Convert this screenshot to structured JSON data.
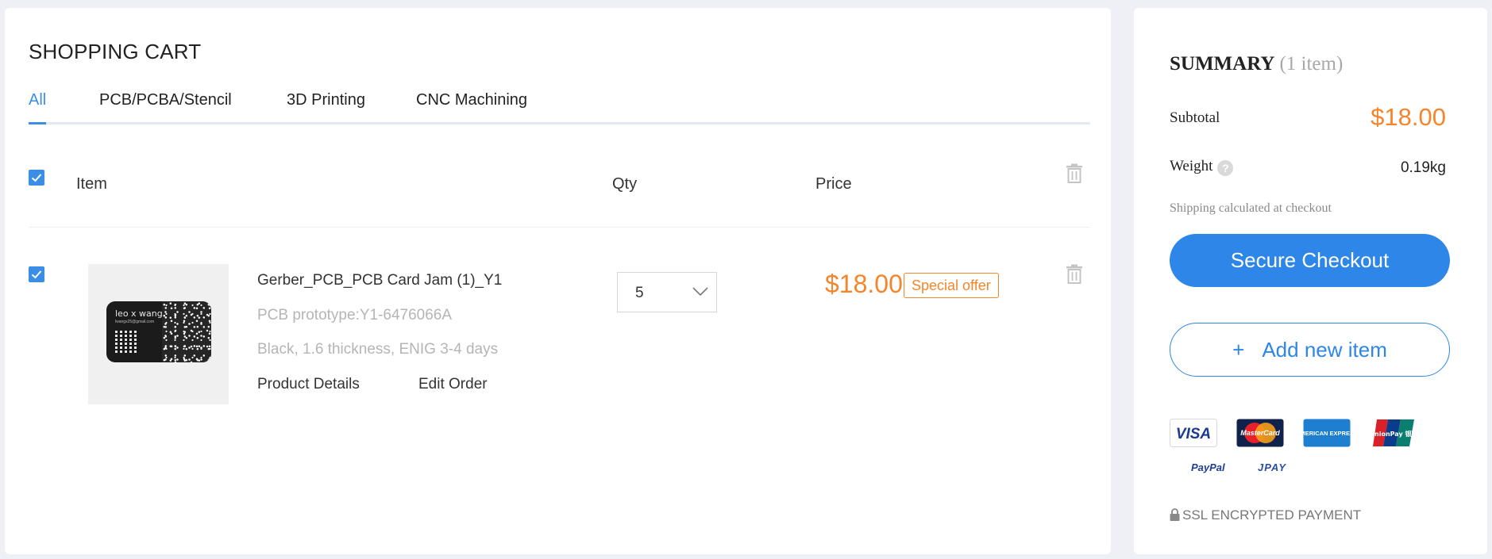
{
  "cart": {
    "title": "SHOPPING CART",
    "tabs": [
      {
        "label": "All",
        "active": true
      },
      {
        "label": "PCB/PCBA/Stencil",
        "active": false
      },
      {
        "label": "3D Printing",
        "active": false
      },
      {
        "label": "CNC Machining",
        "active": false
      }
    ],
    "columns": {
      "item": "Item",
      "qty": "Qty",
      "price": "Price"
    },
    "items": [
      {
        "selected": true,
        "name": "Gerber_PCB_PCB Card Jam (1)_Y1",
        "prototype": "PCB prototype:Y1-6476066A",
        "specs": "Black, 1.6 thickness, ENIG 3-4 days",
        "details_link": "Product Details",
        "edit_link": "Edit Order",
        "qty": "5",
        "price": "$18.00",
        "badge": "Special offer",
        "thumbnail": {
          "name_text": "leo x wang",
          "email_text": "lwangx25@gmail.com"
        }
      }
    ]
  },
  "summary": {
    "title": "SUMMARY",
    "count": "(1 item)",
    "subtotal_label": "Subtotal",
    "subtotal_value": "$18.00",
    "weight_label": "Weight",
    "weight_help_icon": "?",
    "weight_value": "0.19kg",
    "shipping_note": "Shipping calculated at checkout",
    "checkout_label": "Secure Checkout",
    "add_label": "Add new item",
    "add_icon": "+",
    "payment_methods": [
      "VISA",
      "MasterCard",
      "AMERICAN EXPRESS",
      "UnionPay 银联",
      "PayPal",
      "JPAY"
    ],
    "ssl_label": "SSL ENCRYPTED PAYMENT"
  },
  "colors": {
    "accent": "#2e86e8",
    "price": "#f5852a"
  }
}
